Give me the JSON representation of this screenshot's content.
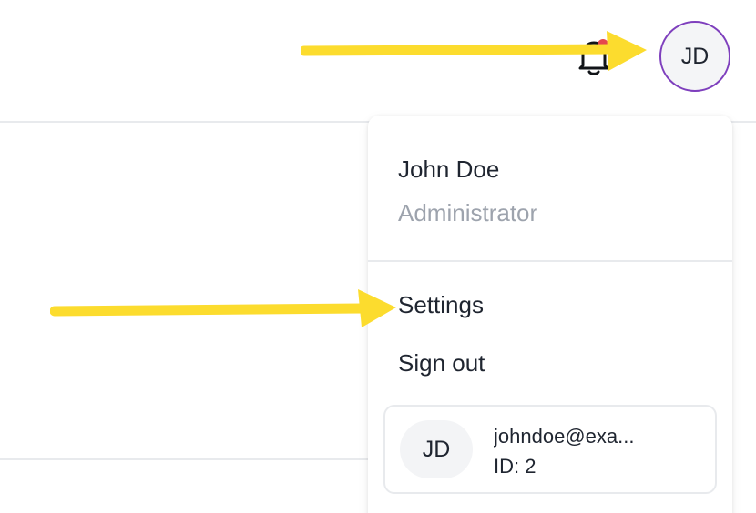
{
  "header": {
    "bell_icon": "bell-icon",
    "notification_dot_color": "#e5484d",
    "avatar_initials": "JD",
    "avatar_border_color": "#7e3fbd"
  },
  "dropdown": {
    "user_name": "John Doe",
    "user_role": "Administrator",
    "items": [
      {
        "label": "Settings"
      },
      {
        "label": "Sign out"
      }
    ],
    "account_card": {
      "initials": "JD",
      "email": "johndoe@exa...",
      "id_text": "ID: 2"
    }
  },
  "annotations": {
    "arrow_color": "#fcdc2e",
    "arrows": [
      "arrow-to-avatar",
      "arrow-to-settings"
    ]
  }
}
